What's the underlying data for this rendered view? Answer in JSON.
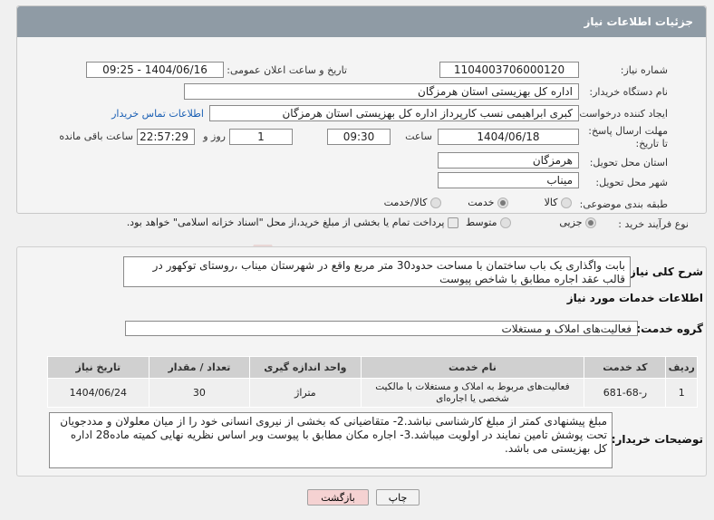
{
  "panel_title": "جزئیات اطلاعات نیاز",
  "need_number": {
    "label": "شماره نیاز:",
    "value": "1104003706000120"
  },
  "announce_datetime": {
    "label": "تاریخ و ساعت اعلان عمومی:",
    "value": "1404/06/16 - 09:25"
  },
  "buyer_org": {
    "label": "نام دستگاه خریدار:",
    "value": "اداره کل بهزیستی استان هرمزگان"
  },
  "requester": {
    "label": "ایجاد کننده درخواست:",
    "value": "کبری  ابراهیمی نسب کارپرداز اداره کل بهزیستی استان هرمزگان",
    "contact_link": "اطلاعات تماس خریدار"
  },
  "deadline": {
    "label": "مهلت ارسال پاسخ: تا تاریخ:",
    "date": "1404/06/18",
    "time_label": "ساعت",
    "time": "09:30",
    "days": "1",
    "days_label": "روز و",
    "remaining": "22:57:29",
    "remaining_label": "ساعت باقی مانده"
  },
  "province": {
    "label": "استان محل تحویل:",
    "value": "هرمزگان"
  },
  "city": {
    "label": "شهر محل تحویل:",
    "value": "میناب"
  },
  "category": {
    "label": "طبقه بندی موضوعی:",
    "options": [
      "کالا",
      "خدمت",
      "کالا/خدمت"
    ],
    "selected": "خدمت"
  },
  "purchase_type": {
    "label": "نوع فرآیند خرید :",
    "options": [
      "جزیی",
      "متوسط"
    ],
    "selected": "جزیی",
    "payment_note": "پرداخت تمام یا بخشی از مبلغ خرید،از محل \"اسناد خزانه اسلامی\" خواهد بود."
  },
  "general_desc": {
    "label": "شرح کلی نیاز:",
    "value": "بابت واگذاری یک باب ساختمان با مساحت حدود30 متر مربع واقع در شهرستان میناب ،روستای توکهور در قالب عقد اجاره مطابق با شاخص پیوست"
  },
  "services_info_title": "اطلاعات خدمات مورد نیاز",
  "service_group": {
    "label": "گروه خدمت:",
    "value": "فعالیت‌های  املاک و مستغلات"
  },
  "table": {
    "headers": [
      "ردیف",
      "کد خدمت",
      "نام خدمت",
      "واحد اندازه گیری",
      "تعداد / مقدار",
      "تاریخ نیاز"
    ],
    "rows": [
      [
        "1",
        "ر-68-681",
        "فعالیت‌های مربوط به املاک و مستغلات با مالکیت شخصی یا اجاره‌ای",
        "متراژ",
        "30",
        "1404/06/24"
      ]
    ]
  },
  "buyer_notes": {
    "label": "توضیحات خریدار:",
    "value": "مبلغ پیشنهادی کمتر از مبلغ کارشناسی نباشد.2- متقاضیانی که بخشی از نیروی انسانی خود را از میان معلولان و مددجویان تحت پوشش تامین نمایند در اولویت میباشد.3-  اجاره مکان  مطابق با پیوست وبر اساس نظریه نهایی کمیته ماده28 اداره کل بهزیستی می باشد."
  },
  "buttons": {
    "print": "چاپ",
    "back": "بازگشت"
  },
  "watermark_text": "AriaTender.neT",
  "colors": {
    "header": "#8f9ba5",
    "back_button": "#f5d2d2",
    "watermark": "#c0392b"
  }
}
